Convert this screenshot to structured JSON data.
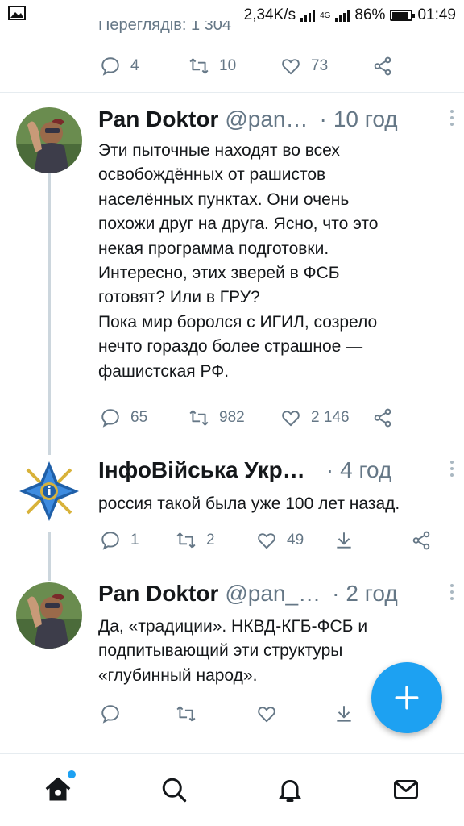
{
  "status_bar": {
    "speed": "2,34K/s",
    "network": "4G",
    "battery": "86%",
    "time": "01:49"
  },
  "previous_tweet": {
    "views_text": "Переглядів: 1 304",
    "replies": "4",
    "retweets": "10",
    "likes": "73"
  },
  "tweets": [
    {
      "name": "Pan Doktor",
      "handle": "@pan…",
      "time": "10 год",
      "text": "Эти пыточные находят во всех\nосвобождённых от рашистов\nнаселённых пунктах. Они очень\nпохожи друг на друга. Ясно, что это\nнекая программа подготовки.\nИнтересно, этих зверей в ФСБ\nготовят? Или в ГРУ?\nПока мир боролся с ИГИЛ, созрело\nнечто гораздо более страшное —\nфашистская РФ.",
      "replies": "65",
      "retweets": "982",
      "likes": "2 146"
    },
    {
      "name": "ІнфоВійська Укр…",
      "handle": "",
      "time": "4 год",
      "text": "россия такой была уже 100 лет назад.",
      "replies": "1",
      "retweets": "2",
      "likes": "49"
    },
    {
      "name": "Pan Doktor",
      "handle": "@pan_…",
      "time": "2 год",
      "text": "Да, «традиции». НКВД-КГБ-ФСБ и\nподпитывающий эти структуры\n«глубинный народ».",
      "replies": "",
      "retweets": "",
      "likes": ""
    }
  ],
  "colors": {
    "accent": "#1da1f2",
    "muted": "#657786",
    "text": "#14171a"
  },
  "icons": {
    "reply": "reply-icon",
    "retweet": "retweet-icon",
    "like": "like-icon",
    "share": "share-icon",
    "download": "download-icon",
    "compose": "compose-plus-icon",
    "home": "home-icon",
    "search": "search-icon",
    "notifications": "bell-icon",
    "messages": "mail-icon"
  }
}
